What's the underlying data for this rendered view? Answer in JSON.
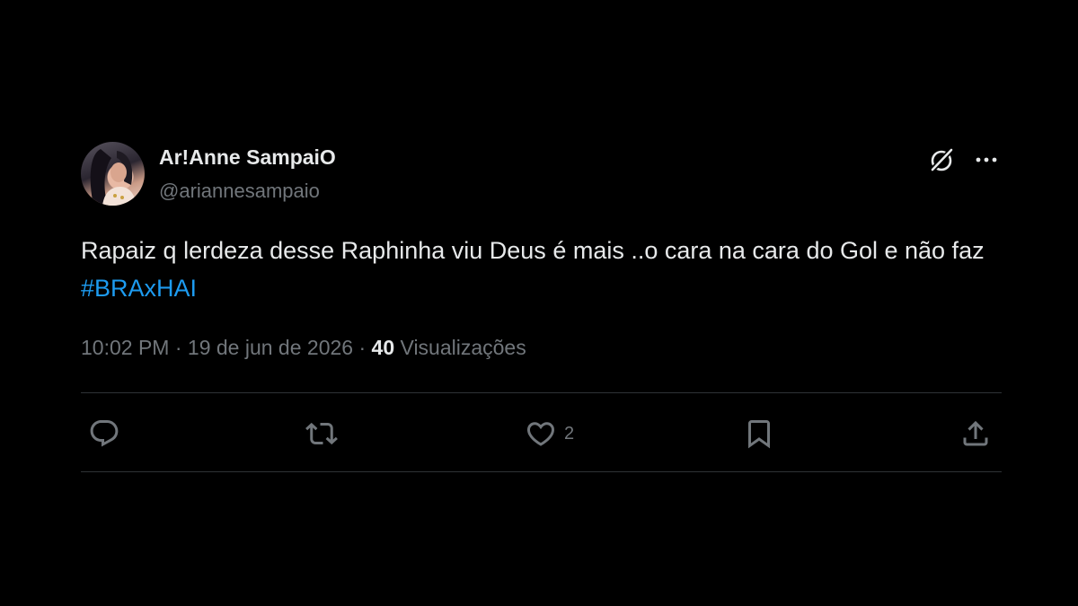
{
  "author": {
    "display_name": "Ar!Anne SampaiO",
    "handle": "@ariannesampaio"
  },
  "tweet": {
    "text": "Rapaiz q lerdeza desse Raphinha viu Deus é mais ..o cara na cara do Gol e não faz ",
    "hashtag": "#BRAxHAI"
  },
  "meta": {
    "time": "10:02 PM",
    "separator": "·",
    "date": "19 de jun de 2026",
    "views_count": "40",
    "views_label": "Visualizações"
  },
  "actions": {
    "likes_count": "2"
  },
  "icons": {
    "grok": "grok-icon",
    "more": "more-icon",
    "reply": "reply-icon",
    "retweet": "retweet-icon",
    "like": "heart-icon",
    "bookmark": "bookmark-icon",
    "share": "share-icon"
  },
  "colors": {
    "background": "#000000",
    "text": "#e7e9ea",
    "secondary": "#71767b",
    "link": "#1d9bf0",
    "divider": "#2f3336"
  }
}
